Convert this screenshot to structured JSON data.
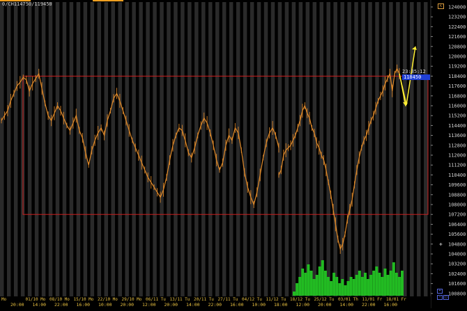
{
  "header": {
    "title": "0/CH114750/119450"
  },
  "colors": {
    "price": "#e08a2a",
    "volume": "#22bb22",
    "box": "#cc2020",
    "arrow": "#ffee33",
    "tag": "#1f3fd6",
    "stripe_dark": "#0b0b0b",
    "stripe_light": "#2a2a2a",
    "axis_text": "#d0d0d0",
    "date_text": "#e8c040",
    "time_text": "#e8c040"
  },
  "icons": [
    "expand-icon",
    "zoom-in-icon",
    "zoom-out-icon",
    "crosshair-icon"
  ],
  "price_tag": {
    "time": "23:35:12",
    "value": "118450"
  },
  "chart_data": {
    "type": "line",
    "title": "",
    "xlabel": "",
    "ylabel": "",
    "ylim": [
      100000,
      124000
    ],
    "y_ticks": [
      "124000",
      "123200",
      "122400",
      "121600",
      "120800",
      "120000",
      "119200",
      "118400",
      "117600",
      "116800",
      "116000",
      "115200",
      "114400",
      "113600",
      "112800",
      "112000",
      "111200",
      "110400",
      "109600",
      "108800",
      "108000",
      "107200",
      "106400",
      "105600",
      "104800",
      "104000",
      "103200",
      "102400",
      "101600",
      "100800"
    ],
    "x_date_labels": [
      "Mo",
      "01/10 Mo",
      "08/10 Mo",
      "15/10 Mo",
      "22/10 Mo",
      "29/10 Mo",
      "06/11 Tu",
      "13/11 Tu",
      "20/11 Tu",
      "27/11 Tu",
      "04/12 Tu",
      "11/12 Tu",
      "18/12 Tu",
      "25/12 Tu",
      "03/01 Th",
      "11/01 Fr",
      "18/01 Fr"
    ],
    "x_time_labels": [
      "20:00",
      "14:00",
      "22:00",
      "16:00",
      "10:00",
      "20:00",
      "12:00",
      "20:00",
      "14:00",
      "22:00",
      "16:00",
      "10:00",
      "18:00",
      "12:00",
      "20:00",
      "14:00",
      "22:00",
      "16:00"
    ],
    "x": [
      0,
      1,
      2,
      3,
      4,
      5,
      6,
      7,
      8,
      9,
      10,
      11,
      12,
      13,
      14,
      15,
      16,
      17,
      18,
      19,
      20,
      21,
      22,
      23,
      24,
      25,
      26,
      27,
      28,
      29,
      30,
      31,
      32,
      33,
      34,
      35,
      36,
      37,
      38,
      39,
      40,
      41,
      42,
      43,
      44,
      45,
      46,
      47,
      48,
      49,
      50,
      51,
      52,
      53,
      54,
      55,
      56,
      57,
      58,
      59,
      60,
      61,
      62,
      63,
      64,
      65,
      66,
      67,
      68,
      69,
      70,
      71,
      72,
      73,
      74,
      75,
      76,
      77,
      78,
      79,
      80,
      81,
      82,
      83,
      84,
      85,
      86,
      87,
      88,
      89
    ],
    "series": [
      {
        "values": [
          114800,
          115200,
          115600,
          116400,
          117000,
          117600,
          117900,
          118300,
          118100,
          117200,
          117800,
          118200,
          118600,
          117400,
          116200,
          115200,
          114800,
          115400,
          116000,
          115600,
          115000,
          114400,
          114000,
          114600,
          115200,
          114000,
          113400,
          112200,
          111200,
          112400,
          113200,
          113800,
          114200,
          113600,
          114800,
          115600,
          116600,
          117000,
          116400,
          115600,
          114800,
          114000,
          113200,
          112600,
          112000,
          111400,
          110800,
          110200,
          109800,
          109400,
          109000,
          108600,
          109200,
          110200,
          111600,
          112800,
          113600,
          114200,
          114000,
          113200,
          112200,
          111800,
          112600,
          113600,
          114400,
          115000,
          114600,
          113800,
          112800,
          111600,
          110800,
          111400,
          112800,
          113600,
          113200,
          114200,
          113800,
          112400,
          110600,
          109400,
          108600,
          108000,
          109000,
          110400,
          111800,
          113000,
          113800,
          114200,
          113600,
          112600
        ],
        "name": ""
      },
      {
        "values": [
          110400,
          110800,
          112000,
          112400,
          112600,
          112800,
          113200,
          113600,
          114200,
          114800,
          115600,
          116000,
          115400,
          115000,
          114200,
          113800,
          113000,
          112600,
          112000,
          111600,
          110800,
          109800,
          108800,
          107600,
          106400,
          105200,
          104400,
          104800,
          105600,
          106800,
          107600,
          108400,
          109600,
          110800,
          111800,
          112600,
          113200,
          113600,
          114200,
          114800,
          115200,
          115800,
          116400,
          116800,
          117200,
          117800,
          118200,
          118600,
          117200,
          118600,
          119000,
          118600
        ],
        "name": ""
      }
    ],
    "volume": {
      "type": "bar",
      "values": [
        2,
        6,
        9,
        13,
        11,
        15,
        12,
        8,
        10,
        14,
        17,
        12,
        9,
        7,
        11,
        9,
        6,
        8,
        5,
        7,
        9,
        8,
        10,
        12,
        9,
        11,
        8,
        10,
        12,
        14,
        11,
        9,
        13,
        10,
        12,
        16,
        11,
        9,
        12
      ]
    },
    "annotations": {
      "range_box": {
        "y_top": 118400,
        "y_bottom": 107200
      },
      "forecast_up_target": 120800,
      "forecast_down_target": 117200,
      "last_price": 118450
    },
    "grid": false,
    "legend": "none"
  }
}
